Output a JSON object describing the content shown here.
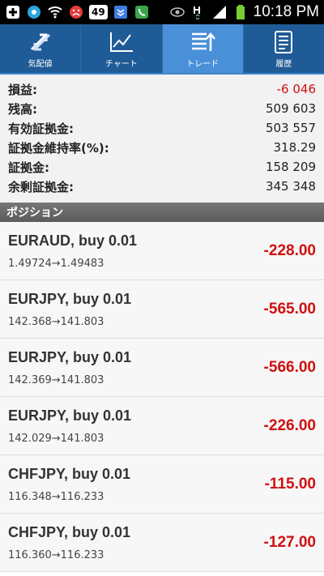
{
  "status_bar": {
    "badge": "49",
    "time": "10:18 PM"
  },
  "tabs": [
    {
      "label": "気配値",
      "icon": "arrows-icon",
      "active": false
    },
    {
      "label": "チャート",
      "icon": "chart-icon",
      "active": false
    },
    {
      "label": "トレード",
      "icon": "trade-icon",
      "active": true
    },
    {
      "label": "履歴",
      "icon": "history-icon",
      "active": false
    }
  ],
  "summary": {
    "profit_label": "損益:",
    "profit_value": "-6 046",
    "balance_label": "残高:",
    "balance_value": "509 603",
    "equity_label": "有効証拠金:",
    "equity_value": "503 557",
    "margin_level_label": "証拠金維持率(%):",
    "margin_level_value": "318.29",
    "margin_label": "証拠金:",
    "margin_value": "158 209",
    "free_margin_label": "余剰証拠金:",
    "free_margin_value": "345 348"
  },
  "section_title": "ポジション",
  "positions": [
    {
      "title": "EURAUD, buy 0.01",
      "rates": "1.49724→1.49483",
      "pnl": "-228.00"
    },
    {
      "title": "EURJPY, buy 0.01",
      "rates": "142.368→141.803",
      "pnl": "-565.00"
    },
    {
      "title": "EURJPY, buy 0.01",
      "rates": "142.369→141.803",
      "pnl": "-566.00"
    },
    {
      "title": "EURJPY, buy 0.01",
      "rates": "142.029→141.803",
      "pnl": "-226.00"
    },
    {
      "title": "CHFJPY, buy 0.01",
      "rates": "116.348→116.233",
      "pnl": "-115.00"
    },
    {
      "title": "CHFJPY, buy 0.01",
      "rates": "116.360→116.233",
      "pnl": "-127.00"
    }
  ],
  "colors": {
    "accent": "#1f5b96",
    "active_tab": "#4a90d9",
    "loss": "#d01010"
  }
}
